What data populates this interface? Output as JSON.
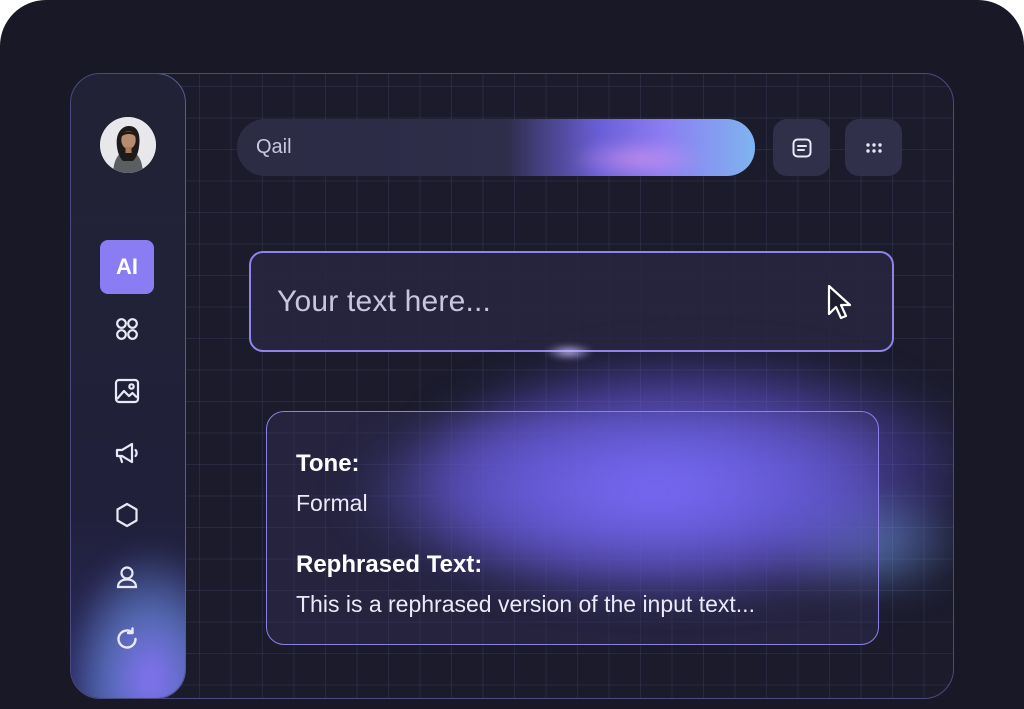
{
  "sidebar": {
    "avatar_alt": "User avatar",
    "items": [
      {
        "label": "AI",
        "icon": "ai-icon",
        "active": true
      },
      {
        "label": "",
        "icon": "apps-grid-icon"
      },
      {
        "label": "",
        "icon": "image-icon"
      },
      {
        "label": "",
        "icon": "megaphone-icon"
      },
      {
        "label": "",
        "icon": "hexagon-icon"
      },
      {
        "label": "",
        "icon": "user-icon"
      },
      {
        "label": "",
        "icon": "refresh-icon"
      }
    ]
  },
  "header": {
    "search_label": "Qail",
    "buttons": [
      {
        "icon": "note-icon"
      },
      {
        "icon": "dots-grid-icon"
      }
    ]
  },
  "input": {
    "placeholder": "Your text here..."
  },
  "result": {
    "tone_label": "Tone:",
    "tone_value": "Formal",
    "rephrased_label": "Rephrased Text:",
    "rephrased_value": "This is a rephrased version of the input text..."
  },
  "colors": {
    "background": "#181826",
    "accent": "#8a7cf2",
    "border": "#8f84ea",
    "glow": "#7d6eff",
    "cyan_glow": "#7fb4f0"
  }
}
